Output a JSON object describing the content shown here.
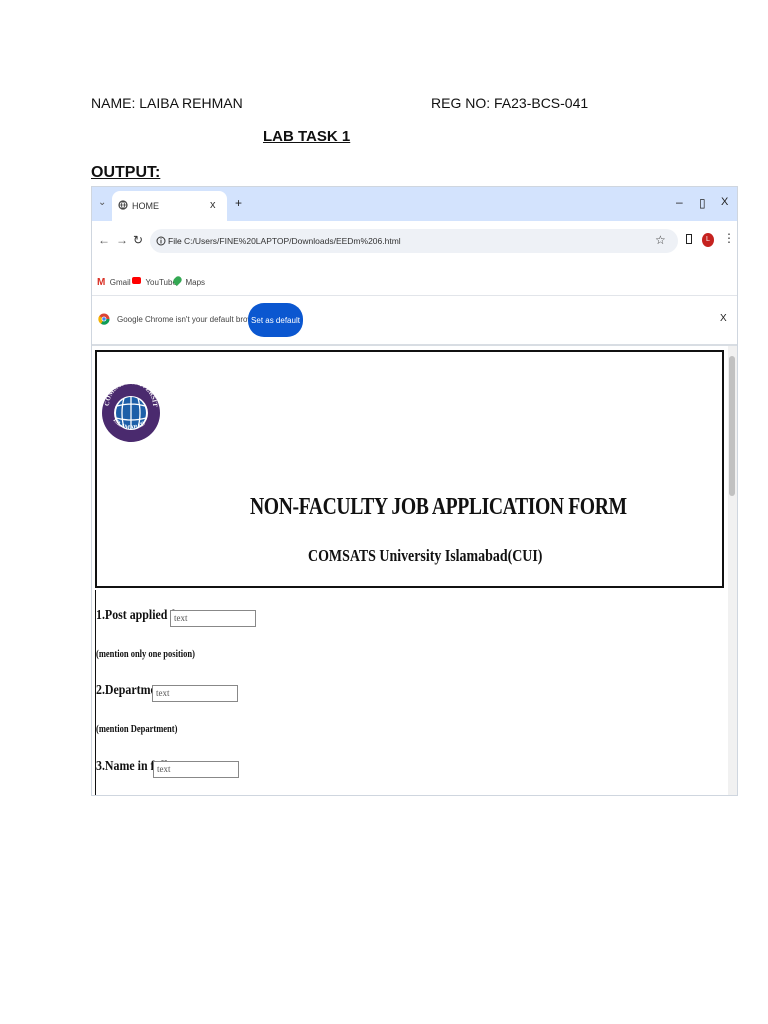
{
  "document": {
    "name_line": "NAME: LAIBA REHMAN",
    "reg_line": "REG NO: FA23-BCS-041",
    "lab_title": "LAB TASK 1",
    "output_label": "OUTPUT:"
  },
  "browser": {
    "tab_title": "HOME",
    "tab_close": "x",
    "new_tab": "+",
    "window_controls": {
      "minimize": "–",
      "restore": "▯",
      "close": "X"
    },
    "url_scheme": "File",
    "url": "C:/Users/FINE%20LAPTOP/Downloads/EEDm%206.html",
    "profile_initial": "L",
    "bookmarks": [
      {
        "label": "Gmail",
        "icon": "gmail-icon",
        "color": "#d93025"
      },
      {
        "label": "YouTube",
        "icon": "youtube-icon",
        "color": "#ff0000"
      },
      {
        "label": "Maps",
        "icon": "maps-icon",
        "color": "#34a853"
      }
    ],
    "infobar": {
      "message": "Google Chrome isn't your default browser",
      "button": "Set as default",
      "close": "X"
    }
  },
  "page": {
    "logo": {
      "top_text": "COMSATS UNIVERSITY",
      "bottom_text": "ISLAMABAD",
      "ring_color": "#4a2a6e"
    },
    "title": "NON-FACULTY JOB APPLICATION FORM",
    "subtitle": "COMSATS University Islamabad(CUI)",
    "fields": [
      {
        "label": "1.Post applied for",
        "placeholder": "text",
        "note": "(mention only one position)"
      },
      {
        "label": "2.Department",
        "placeholder": "text",
        "note": "(mention Department)"
      },
      {
        "label": "3.Name in full",
        "placeholder": "text",
        "note": ""
      }
    ]
  },
  "colors": {
    "tabstrip": "#d3e3fd",
    "accent_button": "#0b57d0",
    "profile": "#c5221f"
  }
}
